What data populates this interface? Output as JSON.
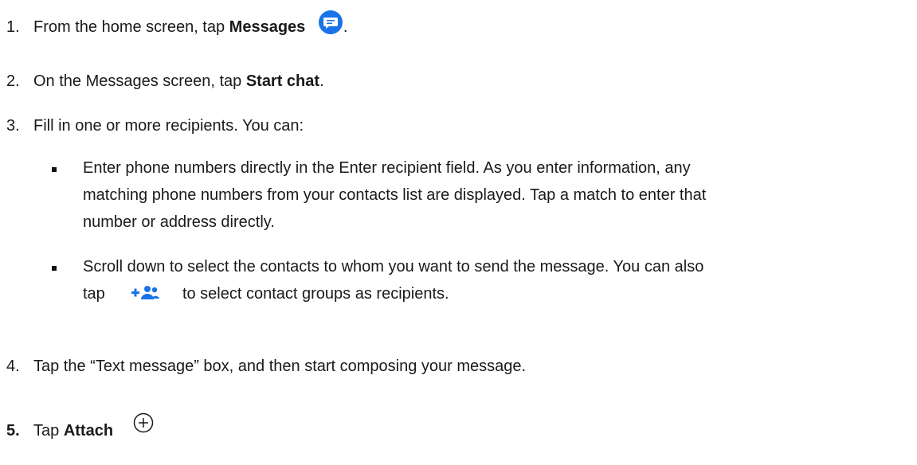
{
  "steps": {
    "s1": {
      "num": "1.",
      "pre": "From the home screen, tap ",
      "bold": "Messages",
      "post": ".",
      "icon": "messages-app-icon"
    },
    "s2": {
      "num": "2.",
      "pre": "On the Messages screen, tap ",
      "bold": "Start chat",
      "post": "."
    },
    "s3": {
      "num": "3.",
      "text": "Fill in one or more recipients. You can:"
    },
    "s4": {
      "num": "4.",
      "text": "Tap the “Text message” box, and then start composing your message."
    },
    "s5": {
      "num": "5.",
      "pre": "Tap ",
      "bold": "Attach",
      "icon": "add-circle-icon"
    }
  },
  "bullets": {
    "b1": {
      "line1": "Enter phone numbers directly in the Enter recipient field. As you enter information, any",
      "line2": "matching phone numbers from your contacts list are displayed. Tap a match to enter that",
      "line3": "number or address directly."
    },
    "b2": {
      "line1": "Scroll down to select the contacts to whom you want to send the message. You can also",
      "line2_pre": "tap",
      "line2_post": "to select contact groups as recipients.",
      "icon": "add-group-icon"
    }
  },
  "colors": {
    "text": "#1a1a1a",
    "accent_blue": "#1a73e8"
  }
}
